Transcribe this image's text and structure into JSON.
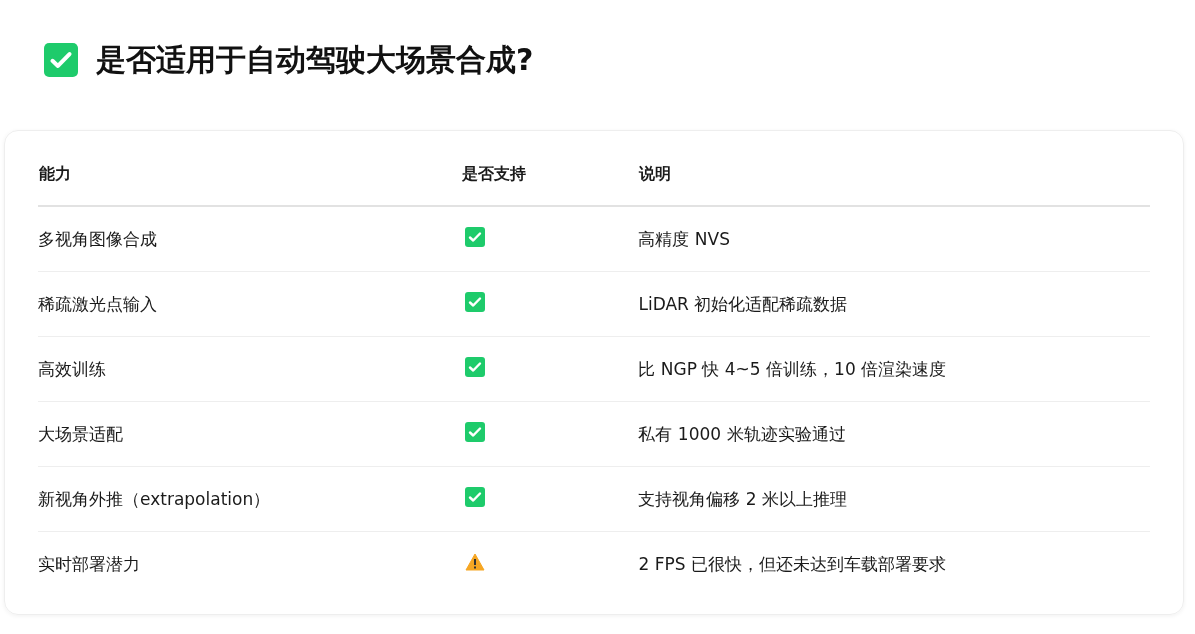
{
  "heading": {
    "title": "是否适用于自动驾驶大场景合成?"
  },
  "table": {
    "columns": [
      "能力",
      "是否支持",
      "说明"
    ],
    "rows": [
      {
        "capability": "多视角图像合成",
        "kind": "check",
        "note": "高精度 NVS"
      },
      {
        "capability": "稀疏激光点输入",
        "kind": "check",
        "note": "LiDAR 初始化适配稀疏数据"
      },
      {
        "capability": "高效训练",
        "kind": "check",
        "note": "比 NGP 快 4~5 倍训练，10 倍渲染速度"
      },
      {
        "capability": "大场景适配",
        "kind": "check",
        "note": "私有 1000 米轨迹实验通过"
      },
      {
        "capability": "新视角外推（extrapolation）",
        "kind": "check",
        "note": "支持视角偏移 2 米以上推理"
      },
      {
        "capability": "实时部署潜力",
        "kind": "warning",
        "note": "2 FPS 已很快，但还未达到车载部署要求"
      }
    ]
  }
}
